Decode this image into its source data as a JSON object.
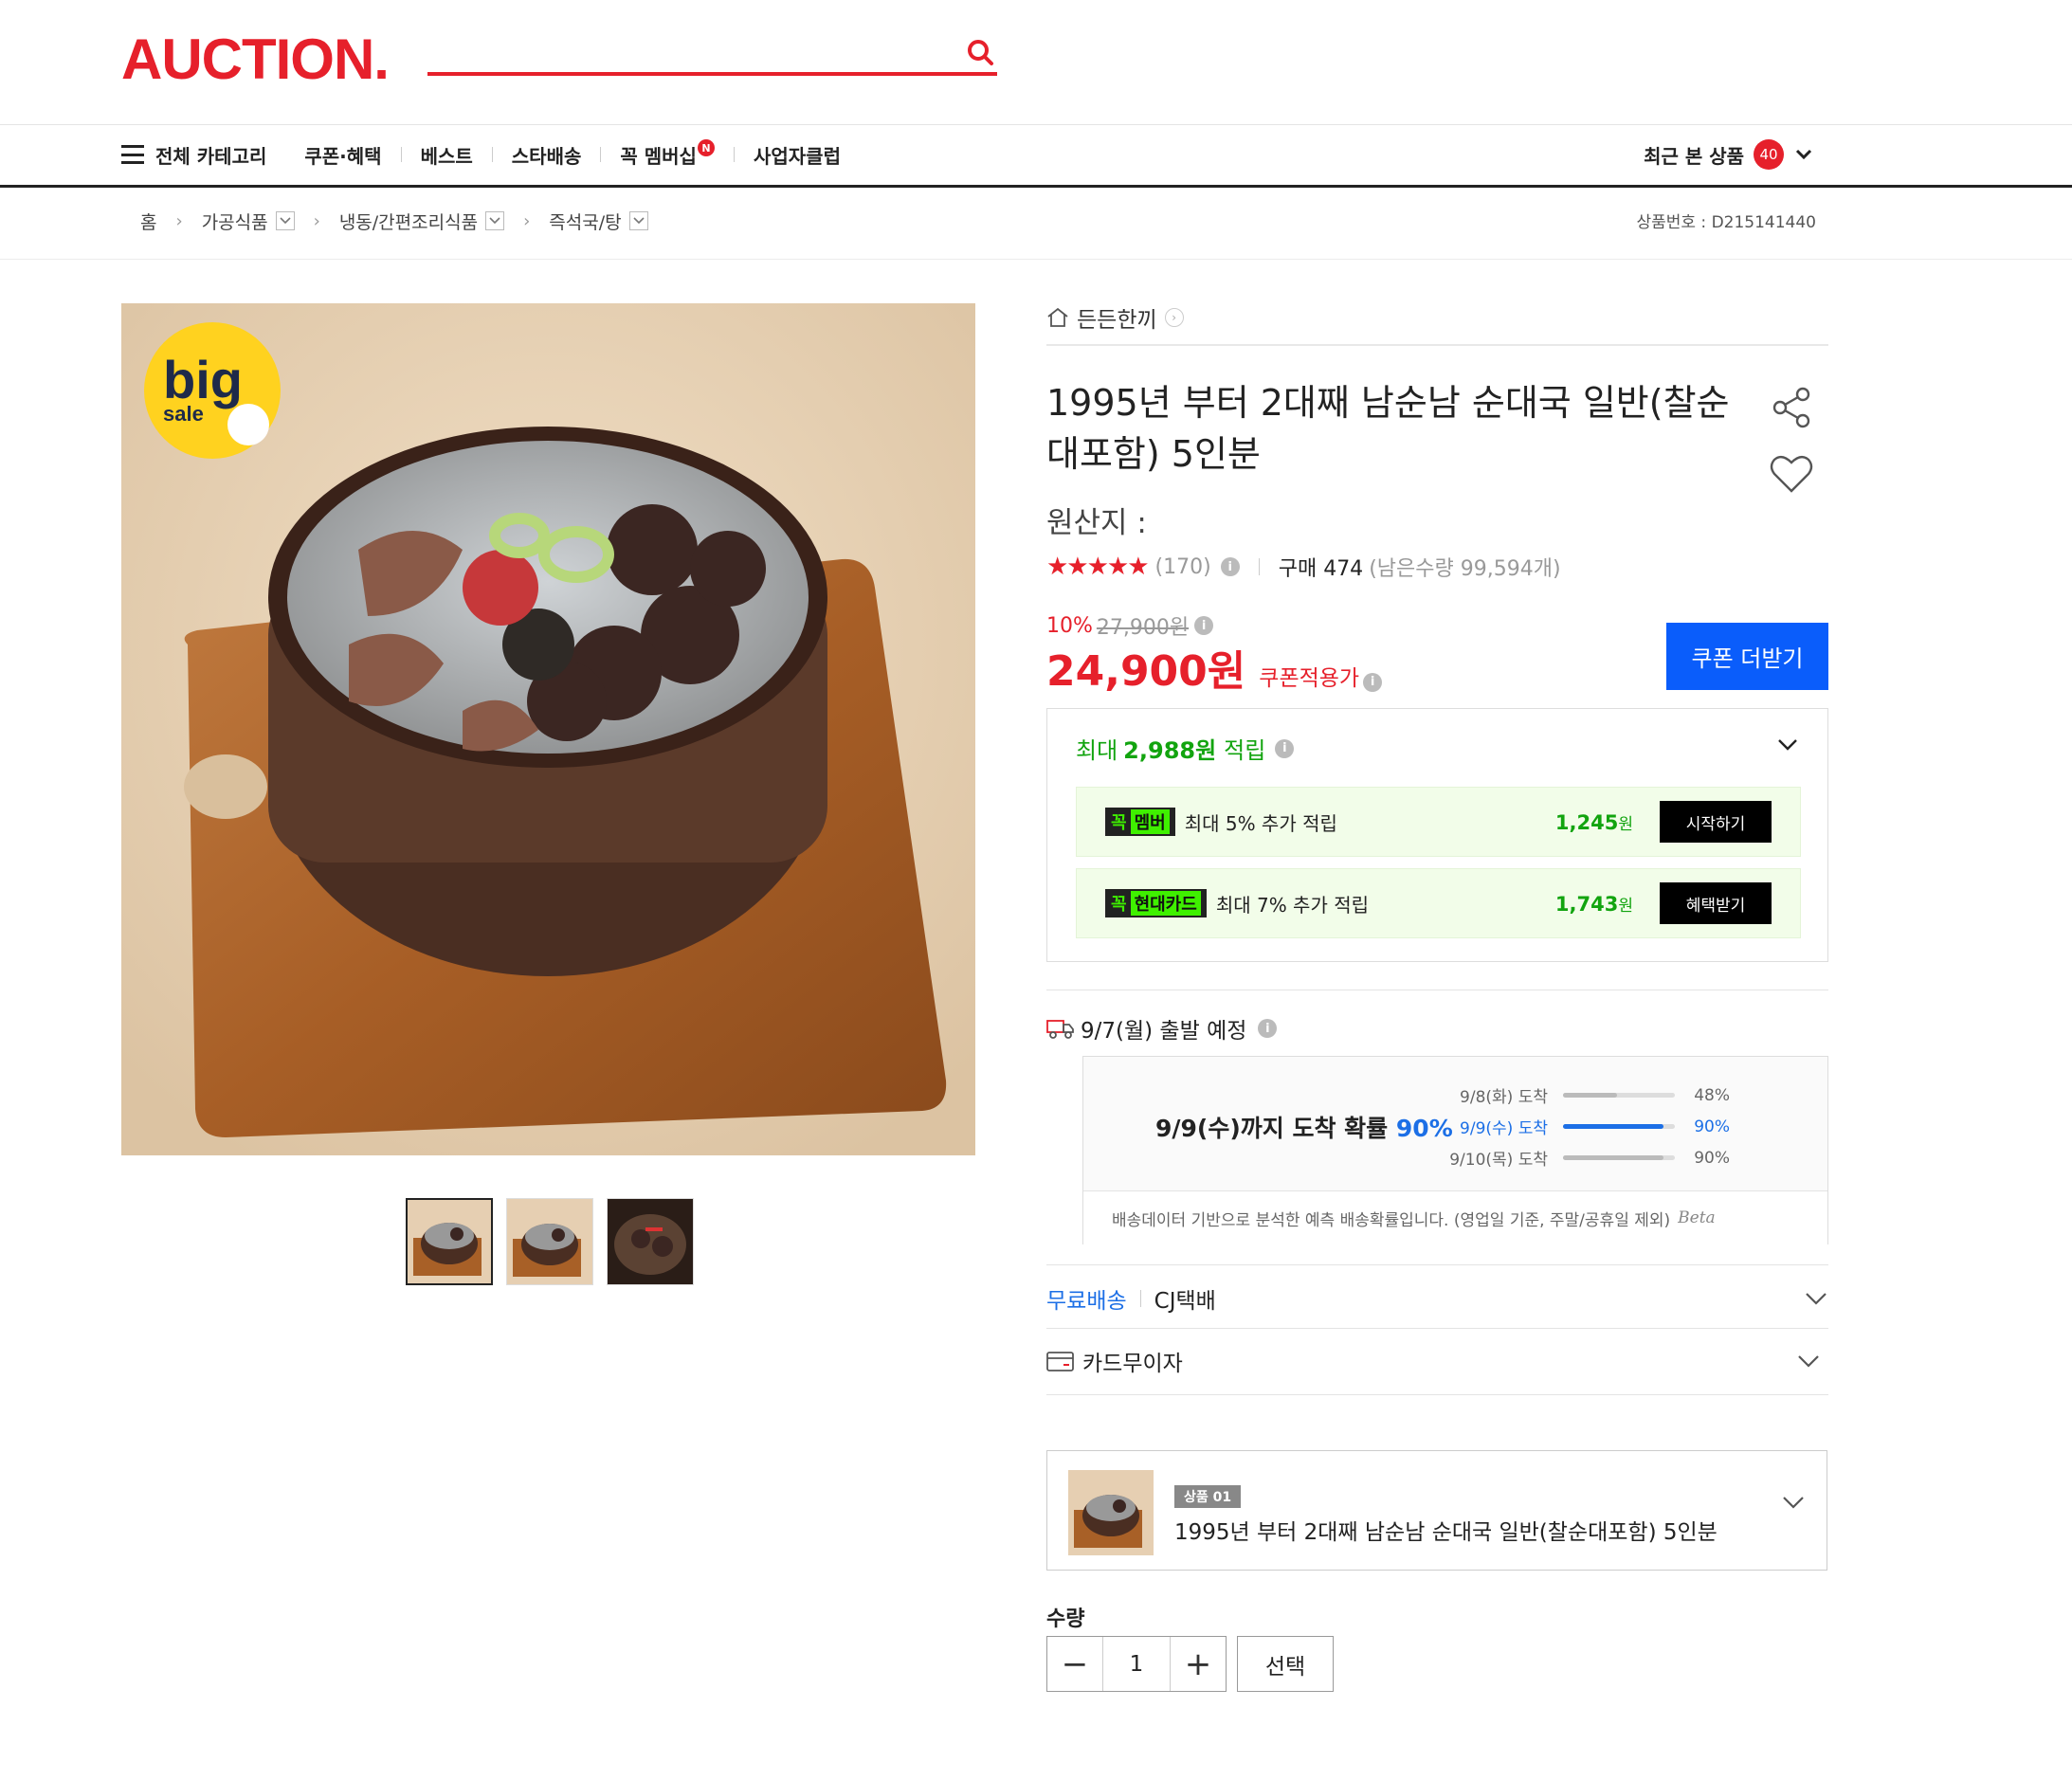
{
  "header": {
    "logo": "AUCTION.",
    "nav": {
      "all_category": "전체 카테고리",
      "items": [
        "쿠폰·혜택",
        "베스트",
        "스타배송",
        "꼭 멤버십",
        "사업자클럽"
      ],
      "membership_badge": "N",
      "recent_label": "최근 본 상품",
      "recent_count": "40"
    }
  },
  "breadcrumb": {
    "home": "홈",
    "levels": [
      "가공식품",
      "냉동/간편조리식품",
      "즉석국/탕"
    ],
    "product_no": "상품번호 : D215141440"
  },
  "product": {
    "store": "든든한끼",
    "title": "1995년 부터 2대째 남순남 순대국 일반(찰순대포함) 5인분",
    "origin": "원산지 :",
    "stars": "★★★★★",
    "rating_stars": 4.5,
    "review_count": "(170)",
    "purchase": "구매 474",
    "stock": "(남은수량 99,594개)",
    "discount_rate": "10%",
    "original_price": "27,900원",
    "price": "24,900원",
    "coupon_applied": "쿠폰적용가",
    "coupon_button": "쿠폰 더받기",
    "big_sale_badge": [
      "big",
      "sale"
    ]
  },
  "reward": {
    "prefix": "최대",
    "amount": "2,988원",
    "suffix": "적립",
    "rows": [
      {
        "tag_prefix": "꼭",
        "tag": "멤버",
        "text": "최대 5% 추가 적립",
        "amount": "1,245",
        "unit": "원",
        "button": "시작하기"
      },
      {
        "tag_prefix": "꼭",
        "tag": "현대카드",
        "text": "최대 7% 추가 적립",
        "amount": "1,743",
        "unit": "원",
        "button": "혜택받기"
      }
    ]
  },
  "shipping": {
    "departure": "9/7(월) 출발 예정",
    "probability_text": "9/9(수)까지 도착 확률",
    "probability_value": "90%",
    "items": [
      {
        "date": "9/8(화) 도착",
        "pct": "48%",
        "fill": 0.48,
        "highlight": false
      },
      {
        "date": "9/9(수) 도착",
        "pct": "90%",
        "fill": 0.9,
        "highlight": true
      },
      {
        "date": "9/10(목) 도착",
        "pct": "90%",
        "fill": 0.9,
        "highlight": false
      }
    ],
    "note": "배송데이터 기반으로 분석한 예측 배송확률입니다. (영업일 기준, 주말/공휴일 제외)",
    "beta": "Beta",
    "free": "무료배송",
    "carrier": "CJ택배",
    "card_installment": "카드무이자"
  },
  "option": {
    "tag": "상품 01",
    "name": "1995년 부터 2대째 남순남 순대국 일반(찰순대포함) 5인분"
  },
  "quantity": {
    "label": "수량",
    "value": "1",
    "minus": "−",
    "plus": "+",
    "select": "선택"
  },
  "colors": {
    "brand_red": "#e6202b",
    "coupon_blue": "#0a5dfb",
    "reward_green": "#12a40f",
    "prob_blue": "#1c6fe6"
  }
}
